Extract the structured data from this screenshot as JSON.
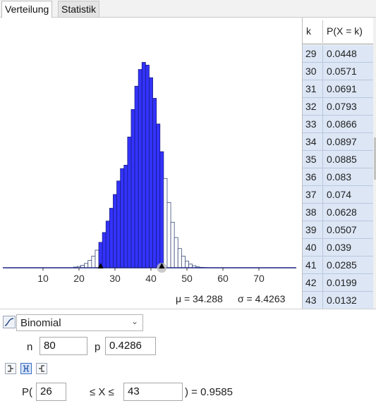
{
  "tabs": {
    "distribution": "Verteilung",
    "statistics": "Statistik"
  },
  "chart_data": {
    "type": "bar",
    "x_start": 0,
    "values": [
      0,
      0,
      0,
      0,
      0,
      0,
      0,
      0,
      0,
      0,
      0,
      0,
      0,
      0,
      0,
      0,
      0,
      0,
      0,
      0.0003,
      0.0006,
      0.0011,
      0.0019,
      0.0032,
      0.0051,
      0.0077,
      0.0111,
      0.0154,
      0.0204,
      0.026,
      0.032,
      0.0379,
      0.0433,
      0.0448,
      0.0571,
      0.0691,
      0.0793,
      0.0866,
      0.0897,
      0.0885,
      0.083,
      0.074,
      0.0628,
      0.0507,
      0.039,
      0.0285,
      0.0199,
      0.0132,
      0.0084,
      0.0051,
      0.0029,
      0.0016,
      0.0009,
      0.0004,
      0.0002,
      0.0001,
      0,
      0,
      0,
      0,
      0,
      0,
      0,
      0,
      0,
      0,
      0,
      0,
      0,
      0,
      0,
      0,
      0,
      0,
      0,
      0,
      0,
      0,
      0,
      0,
      0
    ],
    "highlight_range": [
      26,
      43
    ],
    "xticks": [
      10,
      20,
      30,
      40,
      50,
      60,
      70
    ],
    "xlim": [
      0,
      80
    ]
  },
  "stats": {
    "mean": "μ = 34.288",
    "sd": "σ = 4.4263"
  },
  "table": {
    "header_k": "k",
    "header_p": "P(X = k)",
    "rows": [
      {
        "k": "29",
        "p": "0.0448"
      },
      {
        "k": "30",
        "p": "0.0571"
      },
      {
        "k": "31",
        "p": "0.0691"
      },
      {
        "k": "32",
        "p": "0.0793"
      },
      {
        "k": "33",
        "p": "0.0866"
      },
      {
        "k": "34",
        "p": "0.0897"
      },
      {
        "k": "35",
        "p": "0.0885"
      },
      {
        "k": "36",
        "p": "0.083"
      },
      {
        "k": "37",
        "p": "0.074"
      },
      {
        "k": "38",
        "p": "0.0628"
      },
      {
        "k": "39",
        "p": "0.0507"
      },
      {
        "k": "40",
        "p": "0.039"
      },
      {
        "k": "41",
        "p": "0.0285"
      },
      {
        "k": "42",
        "p": "0.0199"
      },
      {
        "k": "43",
        "p": "0.0132"
      }
    ]
  },
  "controls": {
    "distribution": "Binomial",
    "n_label": "n",
    "n_value": "80",
    "p_label": "p",
    "p_value": "0.4286",
    "prob_prefix": "P(",
    "lower_value": "26",
    "le_x_le": "≤ X ≤",
    "upper_value": "43",
    "result": ") =  0.9585"
  },
  "colors": {
    "bar_fill": "#3333ff",
    "bar_outline": "#1a1a80",
    "row_bg": "#dce6f5"
  }
}
